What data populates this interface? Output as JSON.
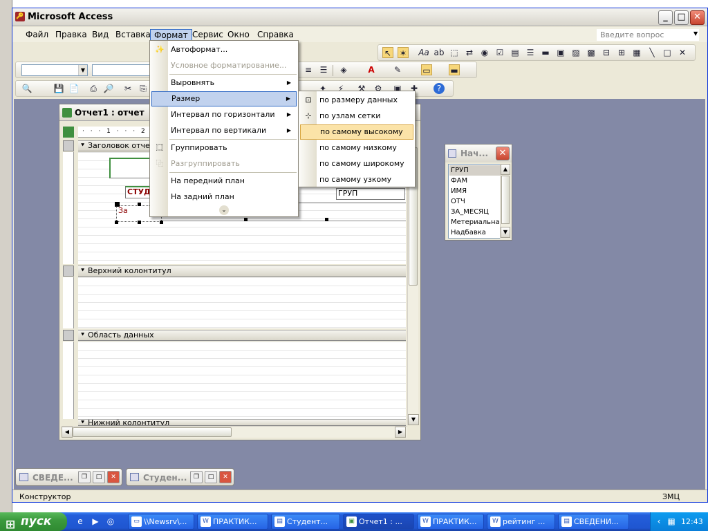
{
  "app": {
    "title": "Microsoft Access"
  },
  "menubar": {
    "items": [
      "Файл",
      "Правка",
      "Вид",
      "Вставка",
      "Формат",
      "Сервис",
      "Окно",
      "Справка"
    ],
    "active": "Формат",
    "ask_placeholder": "Введите вопрос"
  },
  "format_menu": {
    "items": [
      {
        "label": "Автоформат...",
        "icon": "autoformat-icon"
      },
      {
        "label": "Условное форматирование...",
        "disabled": true
      },
      {
        "label": "Выровнять",
        "submenu": true
      },
      {
        "label": "Размер",
        "submenu": true,
        "highlighted": true
      },
      {
        "label": "Интервал по горизонтали",
        "submenu": true
      },
      {
        "label": "Интервал по вертикали",
        "submenu": true
      },
      {
        "label": "Группировать",
        "icon": "group-icon"
      },
      {
        "label": "Разгруппировать",
        "icon": "ungroup-icon",
        "disabled": true
      },
      {
        "label": "На передний план"
      },
      {
        "label": "На задний план"
      }
    ]
  },
  "size_submenu": {
    "items": [
      {
        "label": "по размеру данных",
        "icon": "size-to-fit-icon"
      },
      {
        "label": "по узлам сетки",
        "icon": "size-to-grid-icon"
      },
      {
        "label": "по самому высокому",
        "highlighted": true
      },
      {
        "label": "по самому низкому"
      },
      {
        "label": "по самому широкому"
      },
      {
        "label": "по самому узкому"
      }
    ]
  },
  "report_window": {
    "title": "Отчет1 : отчет",
    "bands": [
      "Заголовок отчет",
      "Верхний колонтитул",
      "Область данных",
      "Нижний колонтитул"
    ],
    "controls": {
      "label1": "СТУДЕ",
      "field_group": "ГРУП",
      "label_za": "За"
    },
    "ruler_numbers": [
      "1",
      "2"
    ]
  },
  "field_list": {
    "title": "Нач...",
    "items": [
      "ГРУП",
      "ФАМ",
      "ИМЯ",
      "ОТЧ",
      "ЗА_МЕСЯЦ",
      "Метериальная",
      "Надбавка"
    ],
    "selected": "ГРУП"
  },
  "minimized": [
    {
      "title": "СВЕДЕ..."
    },
    {
      "title": "Студен..."
    }
  ],
  "status": {
    "left": "Конструктор",
    "right": "ЗМЦ"
  },
  "taskbar": {
    "start": "пуск",
    "tasks": [
      "\\\\Newsrv\\...",
      "ПРАКТИК...",
      "Студент...",
      "Отчет1 : ...",
      "ПРАКТИК...",
      "рейтинг ...",
      "СВЕДЕНИ..."
    ],
    "active_task": "Отчет1 : ...",
    "clock": "12:43"
  }
}
